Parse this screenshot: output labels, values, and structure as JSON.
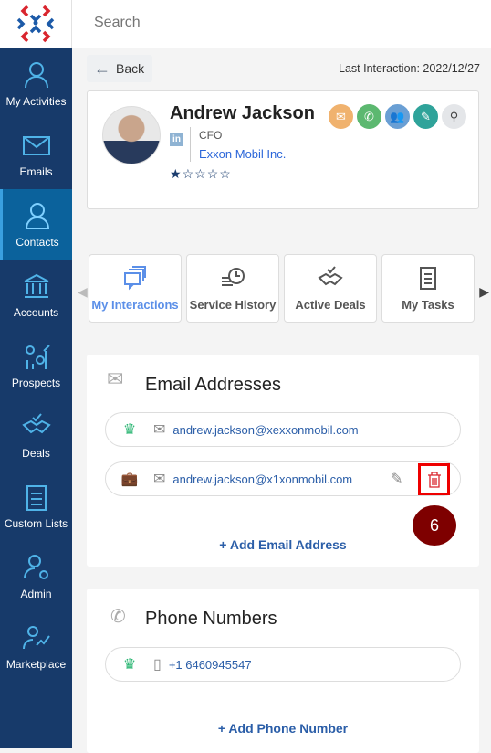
{
  "header": {
    "search_placeholder": "Search"
  },
  "sidebar": {
    "items": [
      {
        "label": "My Activities",
        "icon": "user-check-icon"
      },
      {
        "label": "Emails",
        "icon": "envelope-icon"
      },
      {
        "label": "Contacts",
        "icon": "contact-icon",
        "active": true
      },
      {
        "label": "Accounts",
        "icon": "bank-icon"
      },
      {
        "label": "Prospects",
        "icon": "chart-gear-icon"
      },
      {
        "label": "Deals",
        "icon": "handshake-icon"
      },
      {
        "label": "Custom Lists",
        "icon": "clipboard-list-icon"
      },
      {
        "label": "Admin",
        "icon": "user-gear-icon"
      },
      {
        "label": "Marketplace",
        "icon": "user-growth-icon"
      }
    ]
  },
  "toolbar": {
    "back_label": "Back",
    "last_interaction": "Last Interaction: 2022/12/27"
  },
  "contact": {
    "name": "Andrew Jackson",
    "title": "CFO",
    "company": "Exxon Mobil Inc.",
    "linkedin": "in",
    "rating": 1,
    "rating_max": 5,
    "actions": [
      {
        "icon": "email-icon",
        "color": "#f0b26e"
      },
      {
        "icon": "phone-icon",
        "color": "#5cb870"
      },
      {
        "icon": "meeting-icon",
        "color": "#6a9fd4"
      },
      {
        "icon": "note-icon",
        "color": "#2fa39a"
      },
      {
        "icon": "search-icon",
        "color": "#e4e6e9"
      }
    ]
  },
  "tabs": [
    {
      "label": "My Interactions",
      "active": true
    },
    {
      "label": "Service History"
    },
    {
      "label": "Active Deals"
    },
    {
      "label": "My Tasks"
    }
  ],
  "emails": {
    "title": "Email Addresses",
    "items": [
      {
        "type": "primary",
        "address": "andrew.jackson@xexxonmobil.com"
      },
      {
        "type": "work",
        "address": "andrew.jackson@x1xonmobil.com"
      }
    ],
    "add_label": "+ Add Email Address"
  },
  "phones": {
    "title": "Phone Numbers",
    "items": [
      {
        "type": "primary",
        "number": "+1 6460945547"
      }
    ],
    "add_label": "+ Add Phone Number"
  },
  "step_badge": "6",
  "colors": {
    "sidebar": "#173a6a",
    "active": "#0b629c",
    "link": "#2b5ea8",
    "badge": "#7e0000"
  }
}
